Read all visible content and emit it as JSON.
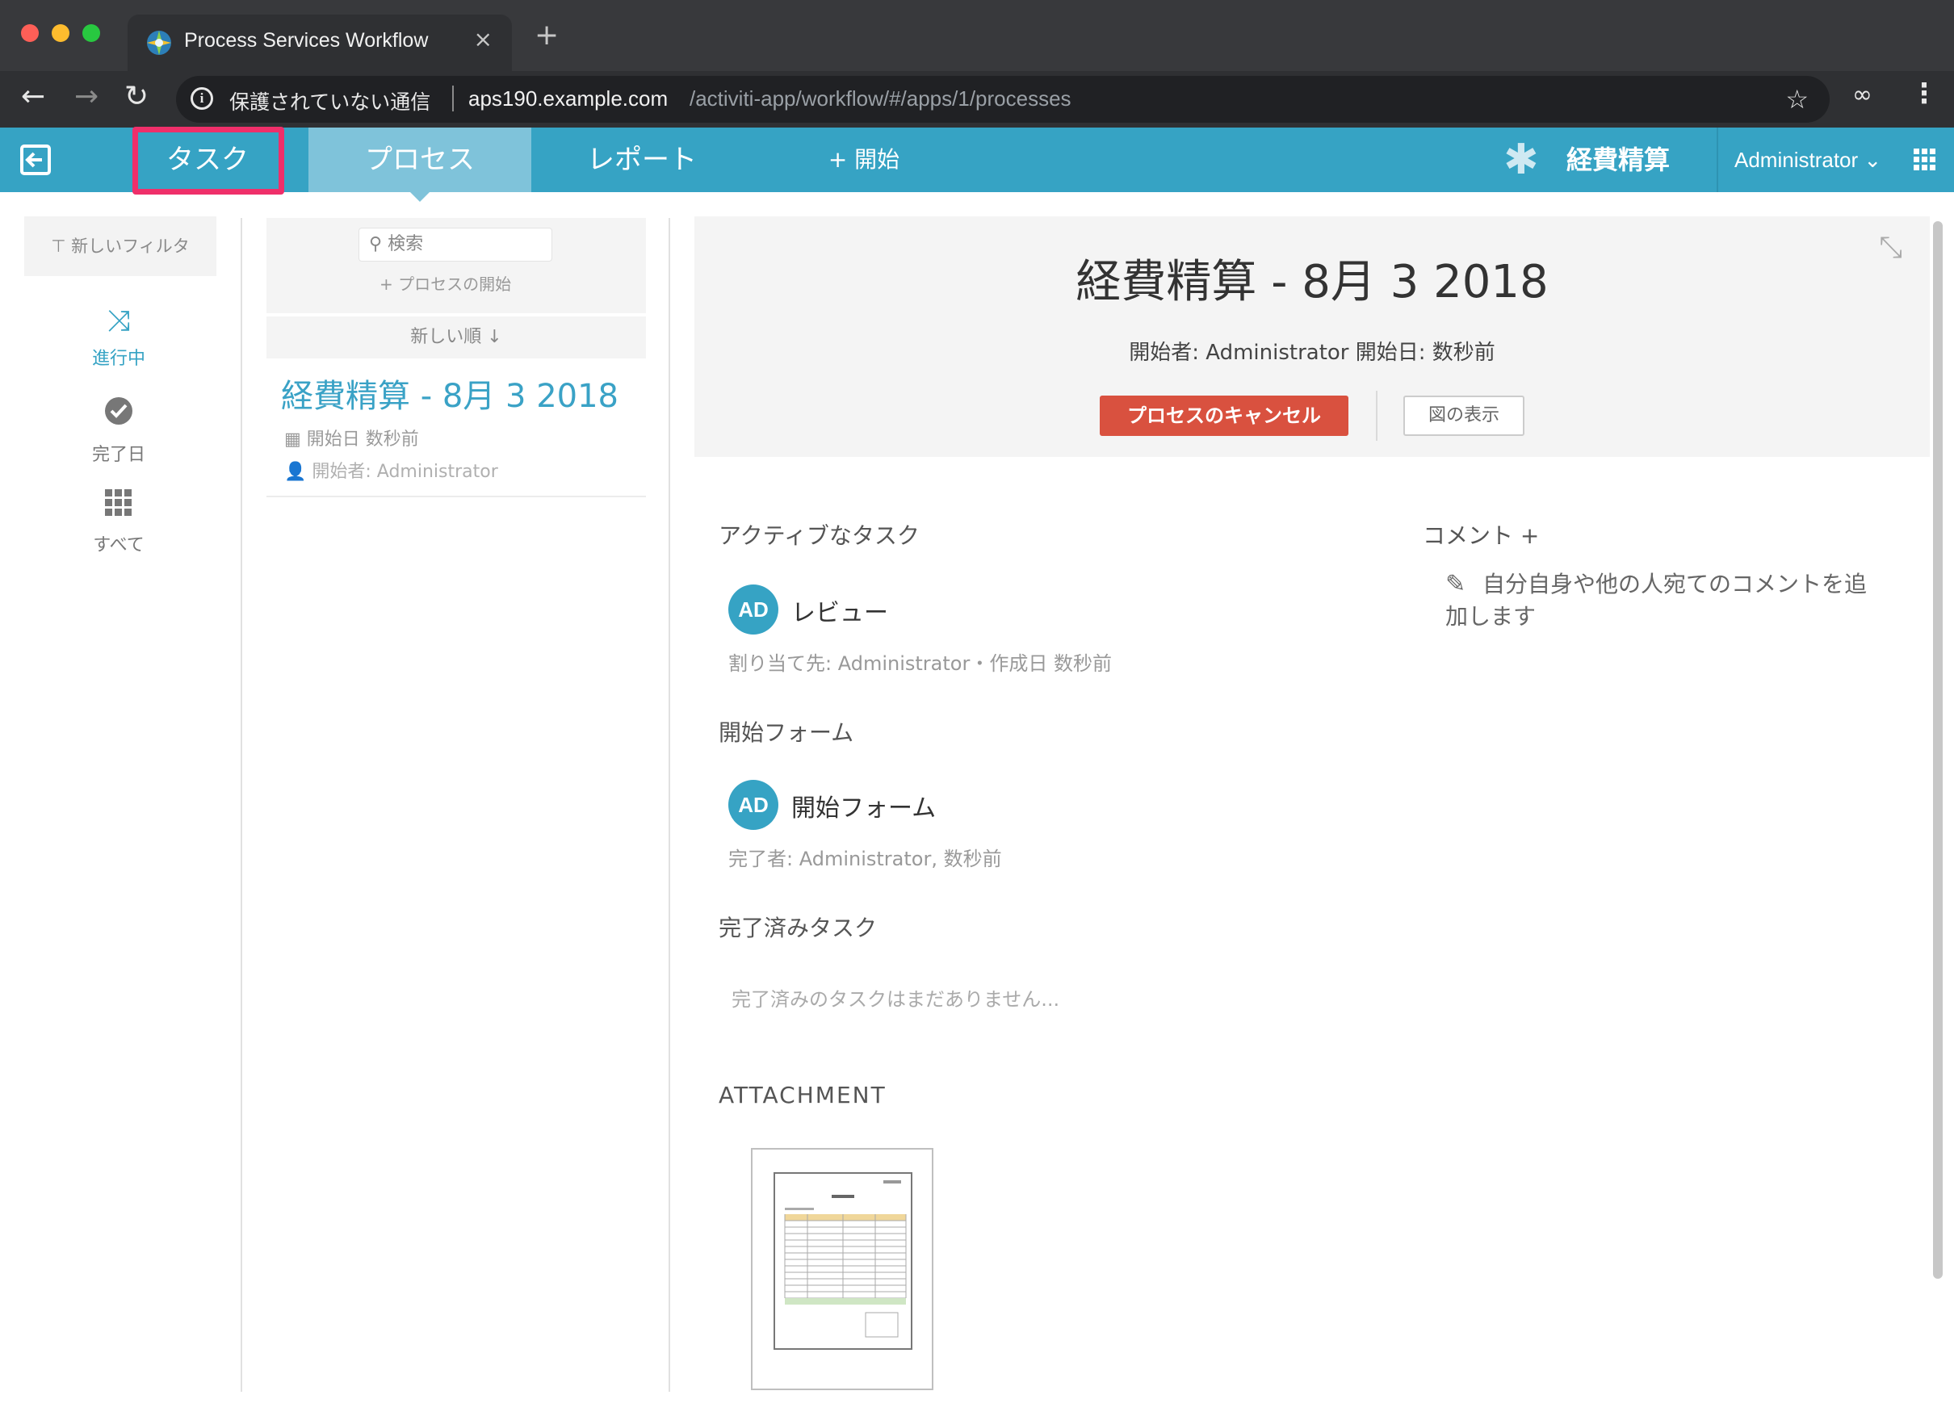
{
  "browser": {
    "tab_title": "Process Services Workflow",
    "tab_close": "×",
    "new_tab": "+",
    "insecure_label": "保護されていない通信",
    "url_host": "aps190.example.com",
    "url_path": "/activiti-app/workflow/#/apps/1/processes"
  },
  "appbar": {
    "tasks": "タスク",
    "processes": "プロセス",
    "reports": "レポート",
    "start": "+ 開始",
    "app_name": "経費精算",
    "user": "Administrator ⌄",
    "colors": {
      "bar": "#36a3c4",
      "active": "#7fc3da",
      "highlight": "#ef2f6a"
    }
  },
  "filters": {
    "new_filter": "⊤ 新しいフィルタ",
    "items": [
      {
        "label": "進行中",
        "icon": "shuffle-icon"
      },
      {
        "label": "完了日",
        "icon": "check-circle-icon"
      },
      {
        "label": "すべて",
        "icon": "grid-icon"
      }
    ]
  },
  "process_list": {
    "search_placeholder": "検索",
    "start_process": "+ プロセスの開始",
    "sort": "新しい順 ↓",
    "items": [
      {
        "title": "経費精算 - 8月 3 2018",
        "started": "開始日 数秒前",
        "starter": "開始者: Administrator"
      }
    ]
  },
  "detail": {
    "title": "経費精算 - 8月 3 2018",
    "meta": "開始者:  Administrator   開始日:  数秒前",
    "cancel_button": "プロセスのキャンセル",
    "diagram_button": "図の表示",
    "active_tasks_heading": "アクティブなタスク",
    "active_tasks": [
      {
        "avatar": "AD",
        "name": "レビュー",
        "sub": "割り当て先: Administrator・作成日 数秒前"
      }
    ],
    "start_form_heading": "開始フォーム",
    "start_form": {
      "avatar": "AD",
      "name": "開始フォーム",
      "sub": "完了者: Administrator, 数秒前"
    },
    "completed_heading": "完了済みタスク",
    "completed_empty": "完了済みのタスクはまだありません...",
    "attachment_heading": "ATTACHMENT",
    "comments_heading": "コメント +",
    "comments_hint": "自分自身や他の人宛てのコメントを追加します"
  }
}
